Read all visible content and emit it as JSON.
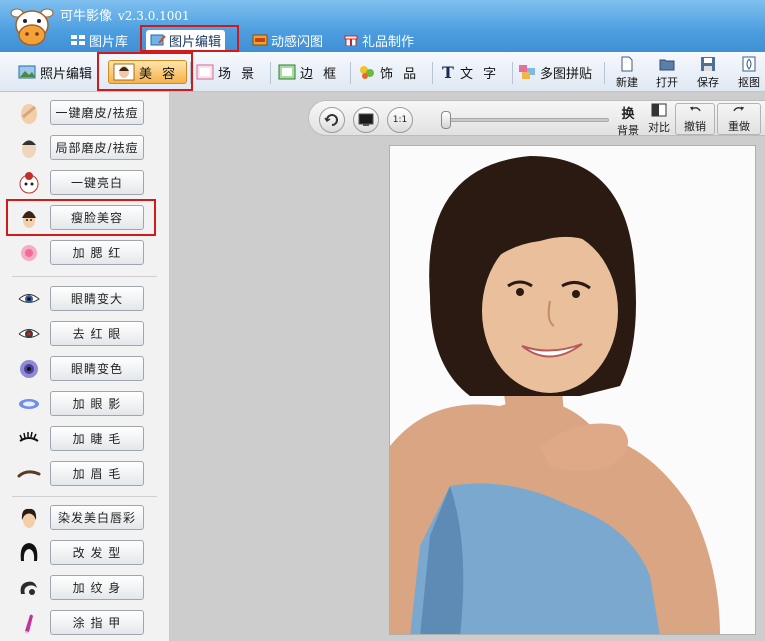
{
  "app": {
    "title": "可牛影像",
    "version": "v2.3.0.1001"
  },
  "top_tabs": [
    {
      "label": "图片库",
      "icon": "grid-icon"
    },
    {
      "label": "图片编辑",
      "icon": "edit-photo-icon",
      "active": true
    },
    {
      "label": "动感闪图",
      "icon": "film-icon"
    },
    {
      "label": "礼品制作",
      "icon": "gift-icon"
    }
  ],
  "sub_tabs": [
    {
      "label": "照片编辑",
      "icon": "photo-edit-icon"
    },
    {
      "label": "美 容",
      "icon": "face-icon",
      "active": true
    },
    {
      "label": "场 景",
      "icon": "scene-icon"
    },
    {
      "label": "边 框",
      "icon": "frame-icon"
    },
    {
      "label": "饰 品",
      "icon": "decoration-icon"
    },
    {
      "label": "文 字",
      "icon": "text-icon"
    },
    {
      "label": "多图拼贴",
      "icon": "collage-icon"
    }
  ],
  "file_tools": [
    {
      "label": "新建",
      "icon": "new-file-icon"
    },
    {
      "label": "打开",
      "icon": "folder-open-icon"
    },
    {
      "label": "保存",
      "icon": "save-icon"
    },
    {
      "label": "抠图",
      "icon": "cutout-icon"
    }
  ],
  "left_panel": {
    "items": [
      {
        "label": "一键磨皮/祛痘",
        "icon": "skin-smooth-icon"
      },
      {
        "label": "局部磨皮/祛痘",
        "icon": "partial-smooth-icon"
      },
      {
        "label": "一键亮白",
        "icon": "whiten-icon"
      },
      {
        "label": "瘦脸美容",
        "icon": "slim-face-icon",
        "highlighted": true
      },
      {
        "label": "加 腮 红",
        "icon": "blush-icon"
      },
      {
        "label": "眼睛变大",
        "icon": "enlarge-eye-icon"
      },
      {
        "label": "去 红 眼",
        "icon": "red-eye-icon"
      },
      {
        "label": "眼睛变色",
        "icon": "eye-color-icon"
      },
      {
        "label": "加 眼 影",
        "icon": "eye-shadow-icon"
      },
      {
        "label": "加 睫 毛",
        "icon": "eyelash-icon"
      },
      {
        "label": "加 眉 毛",
        "icon": "eyebrow-icon"
      },
      {
        "label": "染发美白唇彩",
        "icon": "hair-dye-icon"
      },
      {
        "label": "改 发 型",
        "icon": "hairstyle-icon"
      },
      {
        "label": "加 纹 身",
        "icon": "tattoo-icon"
      },
      {
        "label": "涂 指 甲",
        "icon": "nail-polish-icon"
      }
    ]
  },
  "view_toolbar": {
    "zoom_label": "1:1",
    "tools": [
      {
        "label_top": "换",
        "label": "背景",
        "icon": "background-icon"
      },
      {
        "label": "对比",
        "icon": "compare-icon"
      },
      {
        "label": "撤销",
        "icon": "undo-icon"
      },
      {
        "label": "重做",
        "icon": "redo-icon"
      }
    ]
  },
  "colors": {
    "accent": "#f7b24a",
    "titlebar": "#4d9ee0",
    "highlight": "#d11a1a"
  }
}
